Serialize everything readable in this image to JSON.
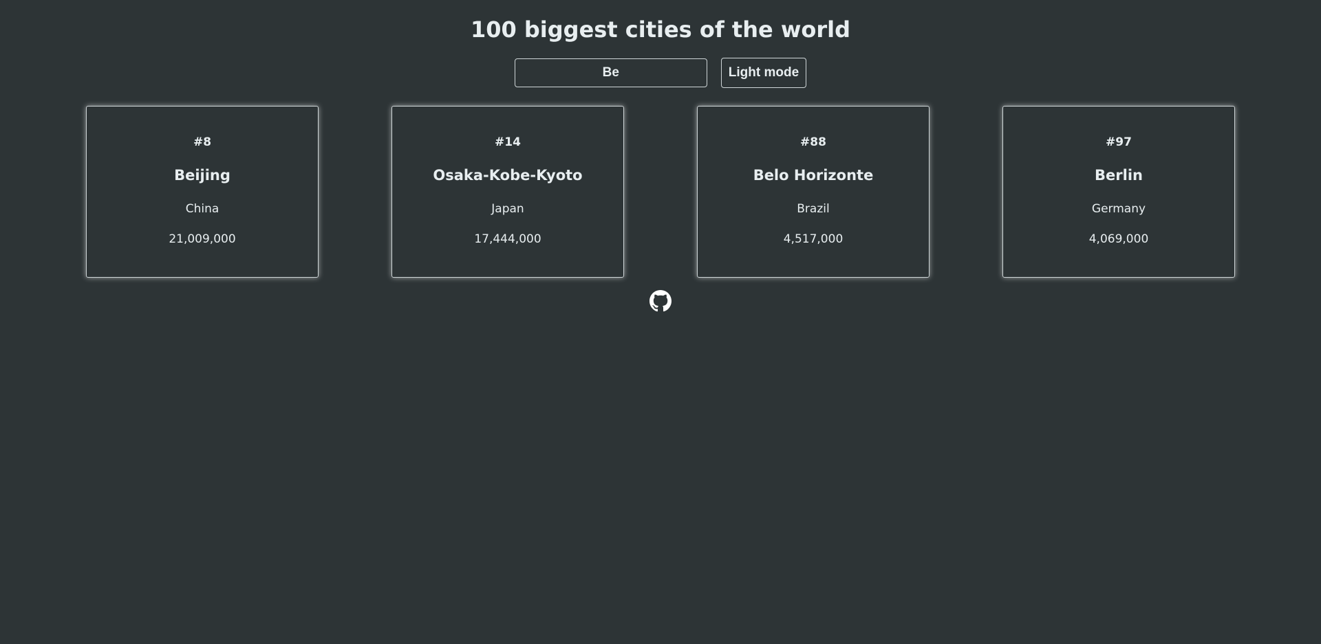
{
  "header": {
    "title": "100 biggest cities of the world"
  },
  "controls": {
    "search_value": "Be",
    "mode_button_label": "Light mode"
  },
  "cities": [
    {
      "rank": "#8",
      "name": "Beijing",
      "country": "China",
      "population": "21,009,000"
    },
    {
      "rank": "#14",
      "name": "Osaka-Kobe-Kyoto",
      "country": "Japan",
      "population": "17,444,000"
    },
    {
      "rank": "#88",
      "name": "Belo Horizonte",
      "country": "Brazil",
      "population": "4,517,000"
    },
    {
      "rank": "#97",
      "name": "Berlin",
      "country": "Germany",
      "population": "4,069,000"
    }
  ],
  "footer": {
    "icon": "github-icon"
  },
  "colors": {
    "background": "#2d3436",
    "text": "#e8eef0",
    "border": "#cfd6d8"
  }
}
